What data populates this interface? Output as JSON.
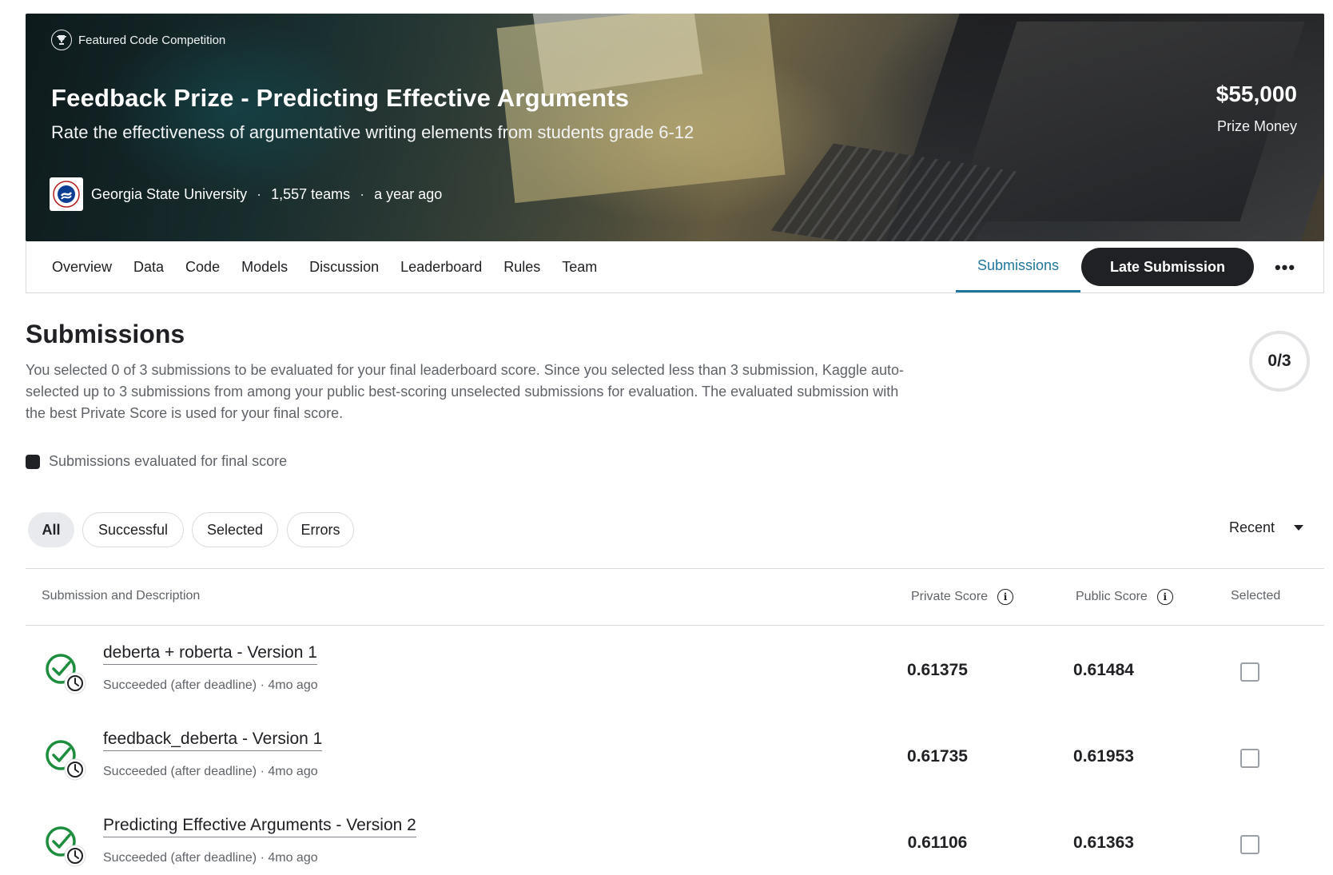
{
  "hero": {
    "featured_label": "Featured Code Competition",
    "title": "Feedback Prize - Predicting Effective Arguments",
    "subtitle": "Rate the effectiveness of argumentative writing elements from students grade 6-12",
    "host": "Georgia State University",
    "teams": "1,557 teams",
    "time": "a year ago",
    "prize_amount": "$55,000",
    "prize_label": "Prize Money"
  },
  "tabs": {
    "items": [
      "Overview",
      "Data",
      "Code",
      "Models",
      "Discussion",
      "Leaderboard",
      "Rules",
      "Team"
    ],
    "active": "Submissions",
    "late_submission": "Late Submission",
    "more": "•••"
  },
  "submissions": {
    "title": "Submissions",
    "description": "You selected 0 of 3 submissions to be evaluated for your final leaderboard score. Since you selected less than 3 submission, Kaggle auto-selected up to 3 submissions from among your public best-scoring unselected submissions for evaluation. The evaluated submission with the best Private Score is used for your final score.",
    "counter": "0/3",
    "legend": "Submissions evaluated for final score"
  },
  "filters": {
    "all": "All",
    "successful": "Successful",
    "selected": "Selected",
    "errors": "Errors",
    "sort": "Recent"
  },
  "table": {
    "headers": {
      "description": "Submission and Description",
      "private": "Private Score",
      "public": "Public Score",
      "selected": "Selected"
    },
    "rows": [
      {
        "title": "deberta + roberta - Version 1",
        "status": "Succeeded (after deadline) · 4mo ago",
        "private": "0.61375",
        "public": "0.61484",
        "selected": false
      },
      {
        "title": "feedback_deberta - Version 1",
        "status": "Succeeded (after deadline) · 4mo ago",
        "private": "0.61735",
        "public": "0.61953",
        "selected": false
      },
      {
        "title": "Predicting Effective Arguments - Version 2",
        "status": "Succeeded (after deadline) · 4mo ago",
        "private": "0.61106",
        "public": "0.61363",
        "selected": false
      }
    ]
  },
  "icons": {
    "status": "check-clock-icon",
    "info": "info-icon",
    "trophy": "trophy-icon"
  },
  "colors": {
    "accent": "#20779c",
    "success": "#1e8e3e",
    "dark": "#202124",
    "muted": "#5f6368"
  }
}
